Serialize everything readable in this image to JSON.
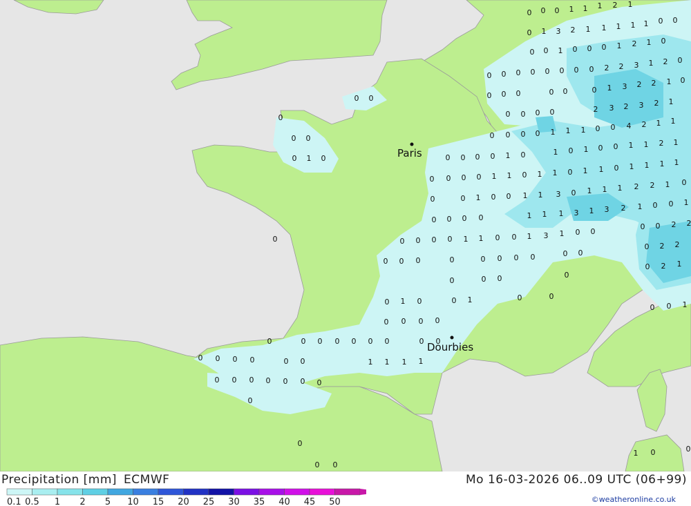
{
  "map": {
    "cities": [
      {
        "name": "Paris"
      },
      {
        "name": "Dourbies"
      }
    ],
    "colors": {
      "sea": "#e6e6e6",
      "land": "#bdee8f",
      "precip_light": "#cdf5f5",
      "precip_mid": "#9ee7ee",
      "precip_heavy": "#6fd4e4"
    }
  },
  "footer": {
    "title_left": "Precipitation [mm]",
    "title_model": "ECMWF",
    "datetime": "Mo 16-03-2026 06..09 UTC (06+99)",
    "credit": "©weatheronline.co.uk"
  },
  "legend": {
    "labels": [
      "0.1",
      "0.5",
      "1",
      "2",
      "5",
      "10",
      "15",
      "20",
      "25",
      "30",
      "35",
      "40",
      "45",
      "50"
    ],
    "colors": [
      "#cdf6f6",
      "#a9eef0",
      "#86e3ea",
      "#5fcfe4",
      "#41a7e0",
      "#3a7fe0",
      "#2f56d8",
      "#2132c4",
      "#1212a6",
      "#7b10e4",
      "#a810e8",
      "#d010e8",
      "#e810d8",
      "#c818a8"
    ]
  }
}
